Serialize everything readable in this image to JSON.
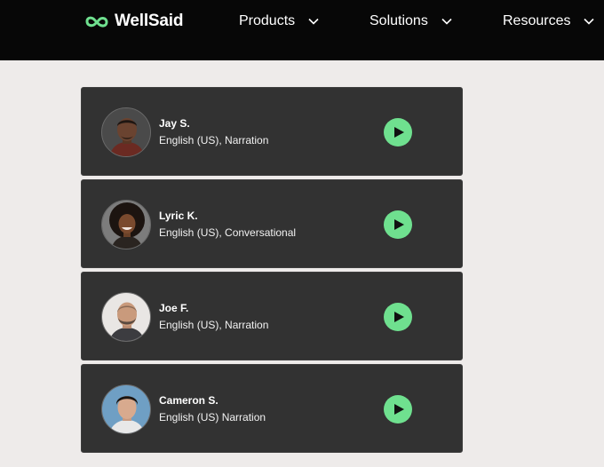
{
  "header": {
    "brand": "WellSaid",
    "brand_color": "#6fe08f",
    "nav": [
      {
        "label": "Products",
        "icon": "chevron-down-icon"
      },
      {
        "label": "Solutions",
        "icon": "chevron-down-icon"
      },
      {
        "label": "Resources",
        "icon": "chevron-down-icon"
      }
    ]
  },
  "voices": [
    {
      "name": "Jay S.",
      "description": "English (US), Narration",
      "avatar": "avatar-photo",
      "action": "play-icon"
    },
    {
      "name": "Lyric K.",
      "description": "English (US), Conversational",
      "avatar": "avatar-photo",
      "action": "play-icon"
    },
    {
      "name": "Joe F.",
      "description": "English (US), Narration",
      "avatar": "avatar-photo",
      "action": "play-icon"
    },
    {
      "name": "Cameron S.",
      "description": "English (US) Narration",
      "avatar": "avatar-photo",
      "action": "play-icon"
    }
  ],
  "colors": {
    "topbar": "#070707",
    "page_background": "#eeebea",
    "card_background": "#323232",
    "play_button": "#6fe08f"
  }
}
